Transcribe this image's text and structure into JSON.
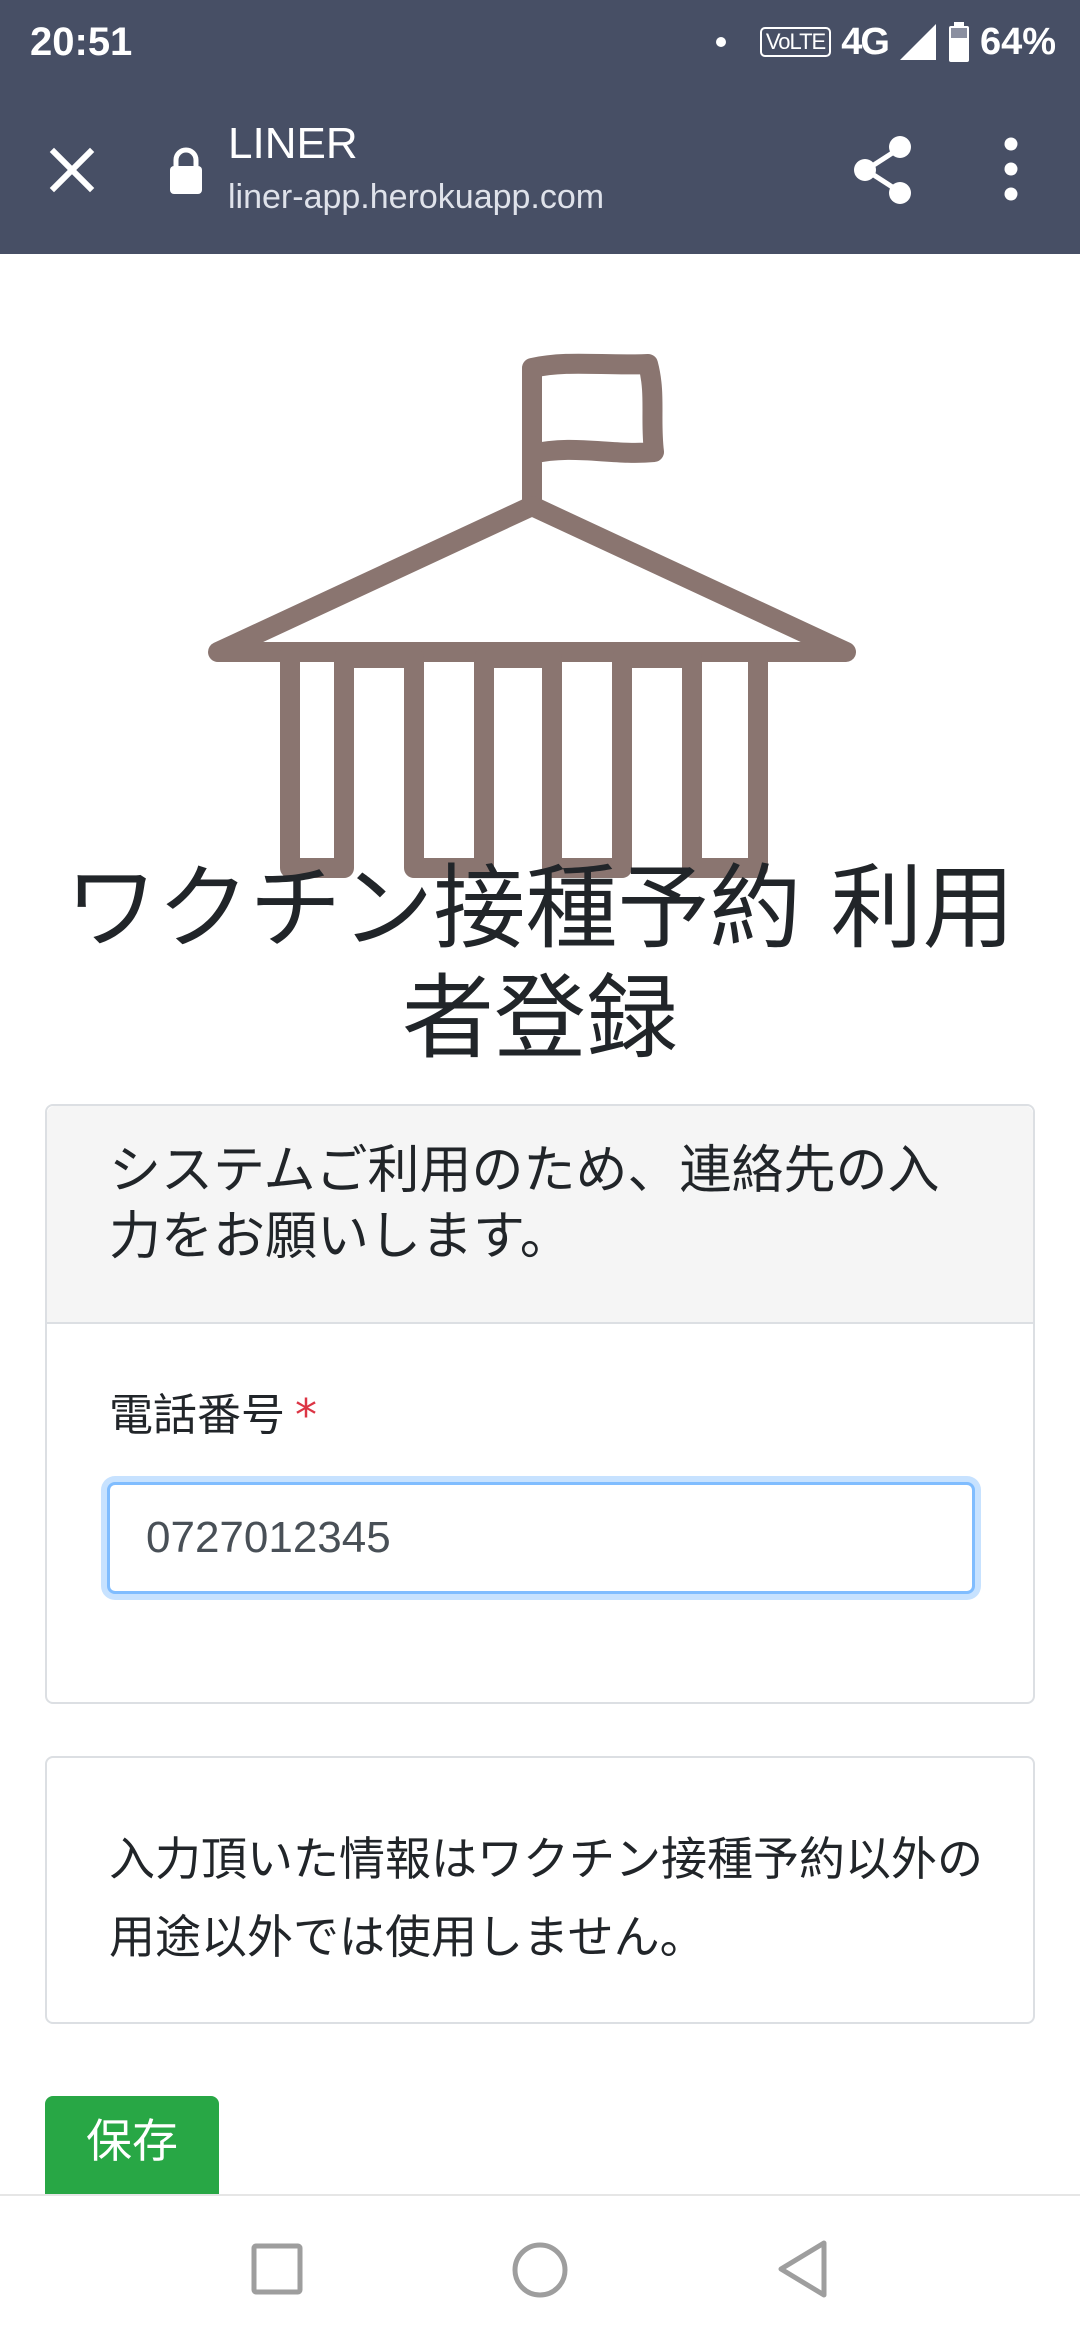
{
  "status_bar": {
    "time": "20:51",
    "volte": "VoLTE",
    "network": "4G",
    "battery": "64%"
  },
  "browser": {
    "title": "LINER",
    "url": "liner-app.herokuapp.com",
    "icons": [
      "close-icon",
      "lock-icon",
      "share-icon",
      "more-vert-icon"
    ]
  },
  "page": {
    "title": "ワクチン接種予約 利用者登録",
    "logo_icon": "school-building-icon",
    "logo_color": "#8a7570"
  },
  "form": {
    "header": "システムご利用のため、連絡先の入力をお願いします。",
    "phone_label": "電話番号",
    "required_mark": "*",
    "phone_value": "0727012345"
  },
  "notice": {
    "text": "入力頂いた情報はワクチン接種予約以外の用途以外では使用しません。"
  },
  "actions": {
    "save_label": "保存",
    "save_color": "#28a745"
  },
  "nav": {
    "icons": [
      "recents-icon",
      "home-icon",
      "back-icon"
    ]
  }
}
